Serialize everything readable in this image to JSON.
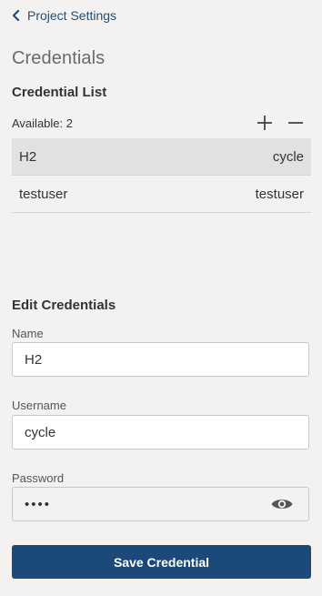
{
  "header": {
    "back_label": "Project Settings",
    "title": "Credentials"
  },
  "credential_list": {
    "title": "Credential List",
    "available_label": "Available: 2",
    "add_icon": "plus-icon",
    "remove_icon": "minus-icon",
    "rows": [
      {
        "name": "H2",
        "username": "cycle",
        "selected": true
      },
      {
        "name": "testuser",
        "username": "testuser",
        "selected": false
      }
    ]
  },
  "edit": {
    "title": "Edit Credentials",
    "name_label": "Name",
    "name_value": "H2",
    "username_label": "Username",
    "username_value": "cycle",
    "password_label": "Password",
    "password_value": "••••",
    "reveal_icon": "eye-icon",
    "save_label": "Save Credential"
  },
  "colors": {
    "background": "#f3f2f1",
    "primary_button": "#1b4a7a",
    "link": "#1f4e79",
    "selected_row": "#e1e1e4"
  }
}
